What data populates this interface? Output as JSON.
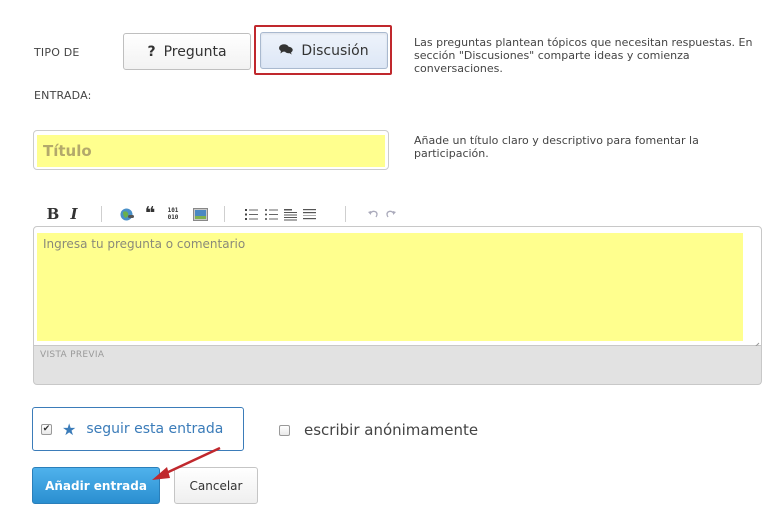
{
  "post_type": {
    "label_line1": "TIPO DE",
    "label_line2": "ENTRADA:",
    "question_icon": "?",
    "question_label": "Pregunta",
    "discussion_label": "Discusión",
    "help_line1": "Las preguntas plantean tópicos que necesitan respuestas. En",
    "help_line2": "sección \"Discusiones\" comparte ideas y comienza",
    "help_line3": "conversaciones."
  },
  "title": {
    "placeholder": "Título",
    "help_line1": "Añade un título claro y descriptivo para fomentar la",
    "help_line2": "participación."
  },
  "toolbar": {
    "bold": "B",
    "italic": "I",
    "quote": "❝",
    "code": "101\n010"
  },
  "editor": {
    "placeholder": "Ingresa tu pregunta o comentario",
    "preview_label": "VISTA PREVIA"
  },
  "options": {
    "follow_label": "seguir esta entrada",
    "follow_checked": true,
    "anonymous_label": "escribir anónimamente",
    "anonymous_checked": false
  },
  "actions": {
    "submit_label": "Añadir entrada",
    "cancel_label": "Cancelar"
  },
  "colors": {
    "highlight": "#ffff8e",
    "annotation_red": "#c0282d",
    "link_blue": "#3b7cb9",
    "primary_button": "#2a8fd0"
  }
}
